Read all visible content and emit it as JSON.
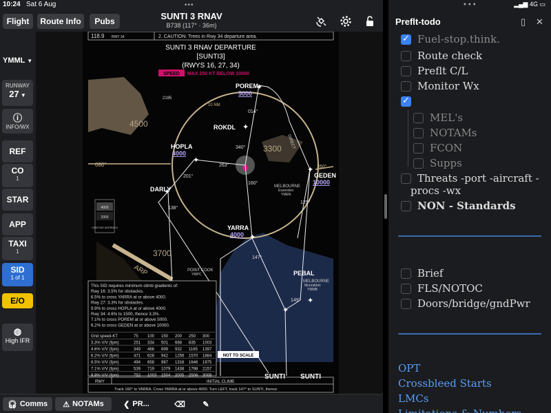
{
  "status": {
    "time": "10:24",
    "date": "Sat 6 Aug",
    "carrier": "4G"
  },
  "toolbar": {
    "flight_label": "Flight",
    "route_info_label": "Route Info",
    "pubs_label": "Pubs",
    "chart_title": "SUNTI 3 RNAV",
    "chart_subtitle": "B738 (117° · 36m)"
  },
  "sidebar": {
    "airport": "YMML",
    "runway_label": "RUNWAY",
    "runway_value": "27",
    "info_label": "INFO/WX",
    "items": [
      {
        "label": "REF",
        "sub": ""
      },
      {
        "label": "CO",
        "sub": "1"
      },
      {
        "label": "STAR",
        "sub": ""
      },
      {
        "label": "APP",
        "sub": ""
      },
      {
        "label": "TAXI",
        "sub": "1"
      },
      {
        "label": "SID",
        "sub": "1 of 1"
      },
      {
        "label": "E/O",
        "sub": ""
      },
      {
        "label": "High IFR",
        "sub": ""
      }
    ]
  },
  "chart": {
    "freq": "118.9",
    "freq_rwy": "RWY 34",
    "caution": "2. CAUTION: Trees in Rwy 34 departure area.",
    "name": "SUNTI 3 RNAV DEPARTURE",
    "code": "[SUNTI3]",
    "runways": "(RWYS 16, 27, 34)",
    "speed_tag": "SPEED",
    "speed_text": "MAX 250 KT BELOW 10000",
    "alt_4500": "4500",
    "alt_3300": "3300",
    "alt_3700": "3700",
    "msa_1": "4000",
    "msa_2": "2000",
    "msa_caption": "CONTOUR INTERVALS",
    "elev": "2195",
    "radial_080": "080°",
    "radial_260": "260°",
    "nm_label": "10 NM",
    "waypoints": {
      "porem": "POREM",
      "porem_alt": "5000",
      "rokdl": "ROKDL",
      "hopla": "HOPLA",
      "hopla_alt": "4000",
      "darly": "DARLY",
      "geden": "GEDEN",
      "geden_alt": "10000",
      "yarra": "YARRA",
      "yarra_alt": "4000",
      "pebal": "PEBAL",
      "sunti_1": "SUNTI",
      "sunti_2": "SUNTI"
    },
    "tracks": {
      "t014": "014°",
      "t340": "340°",
      "t263": "263°",
      "t160": "160°",
      "t201": "201°",
      "t138": "138°",
      "t147": "147°",
      "t125": "125°",
      "t149": "149°"
    },
    "city": "MELBOURNE",
    "city_sub": "Essendon",
    "city_code": "YMEN",
    "melb2": "MELBOURNE",
    "melb2_sub": "Moorabbin",
    "melb2_code": "YMMB",
    "pcook": "POINT COOK",
    "pcook_code": "YMPC",
    "arp": "ARP",
    "direct": "DIRECT",
    "not_to_scale": "NOT TO SCALE",
    "note_lines": [
      "This SID requires minimum climb gradients of:",
      "Rwy 16: 3.5% for obstacles.",
      "6.5% to cross YARRA at or above 4000.",
      "Rwy 27: 3.3% for obstacles.",
      "9.9% to cross HOPLA at or above 4000.",
      "Rwy 34: 4.6% to 1500, thence 3.3%.",
      "7.1% to cross POREM at or above 5000.",
      "6.2% to cross GEDEN at or above 10000."
    ],
    "table_header": [
      "Gnd speed-KT",
      "75",
      "100",
      "150",
      "200",
      "250",
      "300"
    ],
    "table_rows": [
      [
        "3.3% V/V (fpm)",
        "251",
        "334",
        "501",
        "668",
        "835",
        "1003"
      ],
      [
        "4.6% V/V (fpm)",
        "349",
        "466",
        "699",
        "932",
        "1165",
        "1397"
      ],
      [
        "6.2% V/V (fpm)",
        "471",
        "628",
        "942",
        "1256",
        "1570",
        "1884"
      ],
      [
        "6.5% V/V (fpm)",
        "494",
        "658",
        "987",
        "1316",
        "1646",
        "1975"
      ],
      [
        "7.1% V/V (fpm)",
        "539",
        "719",
        "1079",
        "1438",
        "1798",
        "2157"
      ],
      [
        "9.9% V/V (fpm)",
        "752",
        "1003",
        "1504",
        "2005",
        "2506",
        "3008"
      ]
    ],
    "bottom_rwy": "RWY",
    "bottom_climb": "INITIAL CLIMB",
    "bottom_text": "Track 160° to YARRA. Cross YARRA at or above 4000. Turn LEFT, track 147° to SUNTI, thence"
  },
  "bottombar": {
    "comms": "Comms",
    "notams": "NOTAMs",
    "prev": "PR..."
  },
  "notes": {
    "title": "Preflt-todo",
    "items": [
      {
        "text": "Fuel-stop.think.",
        "checked": true,
        "indent": 0,
        "faded": true
      },
      {
        "text": "Route check",
        "checked": false,
        "indent": 0
      },
      {
        "text": "Preflt C/L",
        "checked": false,
        "indent": 0
      },
      {
        "text": "Monitor Wx",
        "checked": false,
        "indent": 0
      },
      {
        "text": "",
        "checked": true,
        "indent": 0
      },
      {
        "text": "MEL's",
        "checked": false,
        "indent": 1,
        "faded": true
      },
      {
        "text": "NOTAMs",
        "checked": false,
        "indent": 1,
        "faded": true
      },
      {
        "text": "FCON",
        "checked": false,
        "indent": 1,
        "faded": true
      },
      {
        "text": "Supps",
        "checked": false,
        "indent": 1,
        "faded": true
      },
      {
        "text": "Threats -port -aircraft -",
        "text2": "procs -wx",
        "checked": false,
        "indent": 0
      },
      {
        "text": "NON - Standards",
        "checked": false,
        "indent": 0,
        "bold": true
      },
      {
        "text": "Brief",
        "checked": false,
        "indent": 0
      },
      {
        "text": "FLS/NOTOC",
        "checked": false,
        "indent": 0
      },
      {
        "text": "Doors/bridge/gndPwr",
        "checked": false,
        "indent": 0
      }
    ],
    "links": [
      "OPT",
      "Crossbleed Starts",
      "LMCs",
      "Limitations & Numbers"
    ]
  },
  "colors": {
    "accent": "#3b82f6",
    "sid_active": "#2f6fd1",
    "eo": "#f2c200",
    "speed": "#d0106a",
    "terrain": "#7a6a55",
    "water": "#1c2a4a"
  }
}
